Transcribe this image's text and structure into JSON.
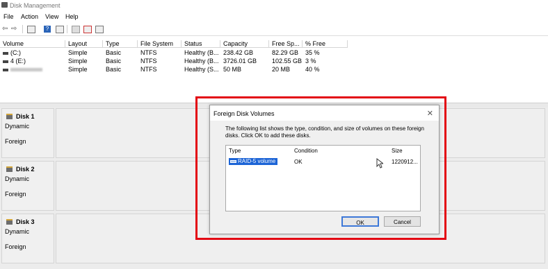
{
  "window": {
    "title": "Disk Management"
  },
  "menu": [
    "File",
    "Action",
    "View",
    "Help"
  ],
  "toolbar": {
    "back_glyph": "⇦",
    "forward_glyph": "⇨",
    "help_glyph": "?"
  },
  "volume_table": {
    "headers": [
      "Volume",
      "Layout",
      "Type",
      "File System",
      "Status",
      "Capacity",
      "Free Sp...",
      "% Free"
    ],
    "rows": [
      {
        "volume": "(C:)",
        "layout": "Simple",
        "type": "Basic",
        "fs": "NTFS",
        "status": "Healthy (B...",
        "capacity": "238.42 GB",
        "free": "82.29 GB",
        "pct": "35 %"
      },
      {
        "volume": "4 (E:)",
        "layout": "Simple",
        "type": "Basic",
        "fs": "NTFS",
        "status": "Healthy (B...",
        "capacity": "3726.01 GB",
        "free": "102.55 GB",
        "pct": "3 %"
      },
      {
        "volume": "",
        "layout": "Simple",
        "type": "Basic",
        "fs": "NTFS",
        "status": "Healthy (S...",
        "capacity": "50 MB",
        "free": "20 MB",
        "pct": "40 %"
      }
    ]
  },
  "disks": [
    {
      "name": "Disk 1",
      "type": "Dynamic",
      "status": "Foreign"
    },
    {
      "name": "Disk 2",
      "type": "Dynamic",
      "status": "Foreign"
    },
    {
      "name": "Disk 3",
      "type": "Dynamic",
      "status": "Foreign"
    }
  ],
  "dialog": {
    "title": "Foreign Disk Volumes",
    "close_glyph": "✕",
    "description": "The following list shows the type, condition, and size of volumes on these foreign disks. Click OK to add these disks.",
    "columns": [
      "Type",
      "Condition",
      "Size"
    ],
    "volume": {
      "type": "RAID-5 volume",
      "condition": "OK",
      "size": "1220912..."
    },
    "ok_label": "OK",
    "cancel_label": "Cancel"
  },
  "highlight_color": "#e30613"
}
